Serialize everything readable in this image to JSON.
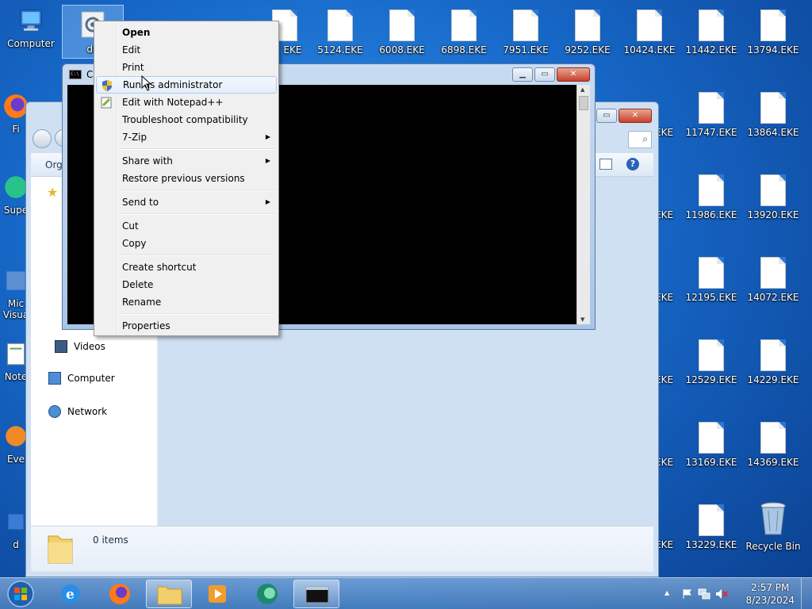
{
  "desktop": {
    "left_icons": [
      {
        "label": "Computer"
      },
      {
        "label": "Fi"
      },
      {
        "label": "Supe"
      },
      {
        "label": "Mic Visua"
      },
      {
        "label": "Note"
      },
      {
        "label": "Eve"
      },
      {
        "label": "d"
      }
    ],
    "selected_file_label": "dd",
    "files_row1": [
      "EKE",
      "5124.EKE",
      "6008.EKE",
      "6898.EKE",
      "7951.EKE",
      "9252.EKE",
      "10424.EKE",
      "11442.EKE",
      "13794.EKE"
    ],
    "col_right_a": [
      "EKE",
      "EKE",
      "EKE",
      "EKE",
      "EKE",
      "EKE"
    ],
    "col_right_b": [
      "11747.EKE",
      "11986.EKE",
      "12195.EKE",
      "12529.EKE",
      "13169.EKE",
      "13229.EKE"
    ],
    "col_right_c": [
      "13864.EKE",
      "13920.EKE",
      "14072.EKE",
      "14229.EKE",
      "14369.EKE"
    ],
    "recycle_bin": "Recycle Bin"
  },
  "explorer": {
    "toolbar_org": "Org",
    "nav": {
      "videos": "Videos",
      "computer": "Computer",
      "network": "Network"
    },
    "status": "0 items"
  },
  "console": {
    "title": "Co"
  },
  "context_menu": {
    "items": [
      {
        "label": "Open"
      },
      {
        "label": "Edit"
      },
      {
        "label": "Print"
      },
      {
        "label": "Run as administrator"
      },
      {
        "label": "Edit with Notepad++"
      },
      {
        "label": "Troubleshoot compatibility"
      },
      {
        "label": "7-Zip"
      },
      {
        "label": "Share with"
      },
      {
        "label": "Restore previous versions"
      },
      {
        "label": "Send to"
      },
      {
        "label": "Cut"
      },
      {
        "label": "Copy"
      },
      {
        "label": "Create shortcut"
      },
      {
        "label": "Delete"
      },
      {
        "label": "Rename"
      },
      {
        "label": "Properties"
      }
    ],
    "submenu_arrow": "▶"
  },
  "taskbar": {
    "time": "2:57 PM",
    "date": "8/23/2024",
    "tray_up_arrow": "▲"
  }
}
